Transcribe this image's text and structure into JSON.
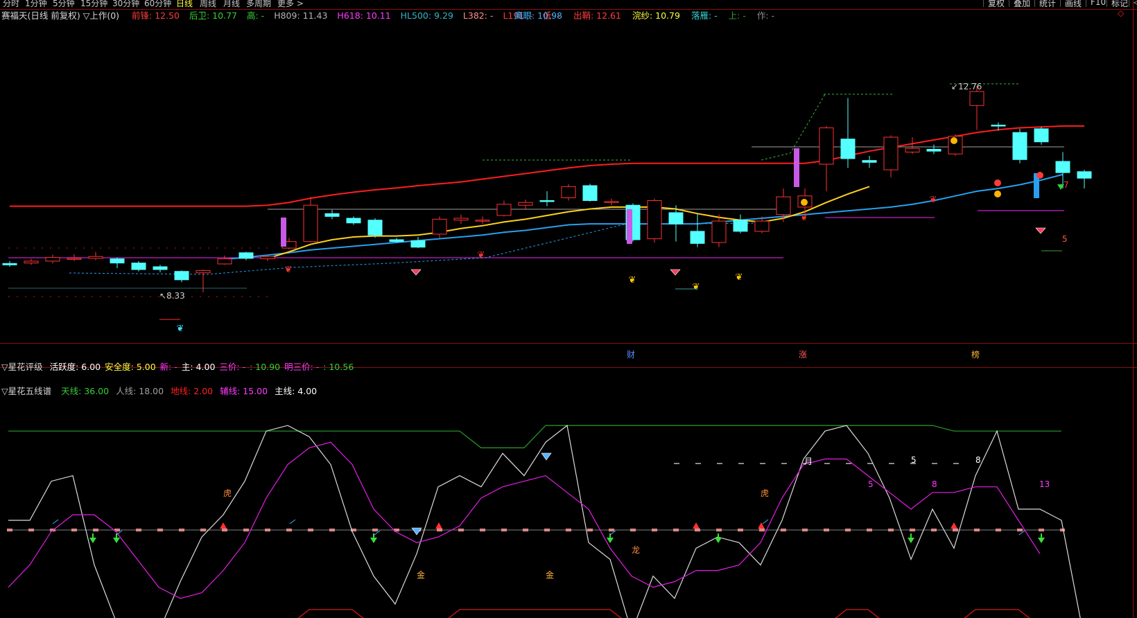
{
  "periods": [
    {
      "label": "分时",
      "x": 4,
      "active": false
    },
    {
      "label": "1分钟",
      "x": 36,
      "active": false
    },
    {
      "label": "5分钟",
      "x": 76,
      "active": false
    },
    {
      "label": "15分钟",
      "x": 116,
      "active": false
    },
    {
      "label": "30分钟",
      "x": 162,
      "active": false
    },
    {
      "label": "60分钟",
      "x": 208,
      "active": false
    },
    {
      "label": "日线",
      "x": 254,
      "active": true
    },
    {
      "label": "周线",
      "x": 288,
      "active": false
    },
    {
      "label": "月线",
      "x": 322,
      "active": false
    },
    {
      "label": "多周期",
      "x": 355,
      "active": false
    },
    {
      "label": "更多 >",
      "x": 400,
      "active": false
    }
  ],
  "toolbar": [
    {
      "label": "复权",
      "x": 1418
    },
    {
      "label": "叠加",
      "x": 1455
    },
    {
      "label": "统计",
      "x": 1492
    },
    {
      "label": "画线",
      "x": 1529
    },
    {
      "label": "F10",
      "x": 1566
    },
    {
      "label": "标记",
      "x": 1596
    }
  ],
  "toolbar_tail": "◁",
  "main": {
    "title": "赛福天(日线 前复权) ▽上作(0)",
    "metrics": [
      {
        "label": "前锋:",
        "value": "12.50",
        "color": "#ff3c3c"
      },
      {
        "label": "后卫:",
        "value": "10.77",
        "color": "#36d036"
      },
      {
        "label": "高:",
        "value": "-",
        "color": "#36d036"
      },
      {
        "label": "H809:",
        "value": "11.43",
        "color": "#b4b4b4"
      },
      {
        "label": "H618:",
        "value": "10.11",
        "color": "#ff3cff"
      },
      {
        "label": "HL500:",
        "value": "9.29",
        "color": "#36b4c8"
      },
      {
        "label": "L382:",
        "value": "-",
        "color": "#ff8c8c"
      },
      {
        "label": "L191:",
        "value": "-",
        "color": "#ff3c3c"
      },
      {
        "label": "低:",
        "value": "-",
        "color": "#ff3c3c"
      }
    ],
    "metrics2": [
      {
        "label": "鹰眼:",
        "value": "10.98",
        "color": "#3cb4ff"
      },
      {
        "label": "出鞘:",
        "value": "12.61",
        "color": "#ff3c3c"
      },
      {
        "label": "浣纱:",
        "value": "10.79",
        "color": "#ffff3c"
      },
      {
        "label": "落雁:",
        "value": "-",
        "color": "#36d0d0"
      },
      {
        "label": "上:",
        "value": "-",
        "color": "#36a036"
      },
      {
        "label": "作:",
        "value": "-",
        "color": "#8c8c8c"
      }
    ],
    "price_high_label": "12.76",
    "price_low_label": "8.33",
    "right_number": "5",
    "right_number2": "7",
    "markers": [
      {
        "text": "财",
        "color": "#5a8cff"
      },
      {
        "text": "涨",
        "color": "#ff5a5a"
      },
      {
        "text": "榜",
        "color": "#ffb43c"
      }
    ]
  },
  "panel2": {
    "title": "▽星花评级",
    "metrics": [
      {
        "label": "活跃度:",
        "value": "6.00",
        "color": "#ffffff"
      },
      {
        "label": "安全度:",
        "value": "5.00",
        "color": "#ffff3c"
      },
      {
        "label": "新:",
        "value": "-",
        "color": "#ff3cff"
      },
      {
        "label": "主:",
        "value": "4.00",
        "color": "#ffffff"
      },
      {
        "label": "三价:",
        "value": "-",
        "color": "#ff3cff"
      },
      {
        "label": ":",
        "value": "10.90",
        "color": "#36d036"
      },
      {
        "label": "明三价:",
        "value": "-",
        "color": "#ff3cff"
      },
      {
        "label": ":",
        "value": "10.56",
        "color": "#36d036"
      }
    ]
  },
  "panel3": {
    "title": "▽星花五线谱",
    "metrics": [
      {
        "label": "天线:",
        "value": "36.00",
        "color": "#36d036"
      },
      {
        "label": "人线:",
        "value": "18.00",
        "color": "#a0a0a0"
      },
      {
        "label": "地线:",
        "value": "2.00",
        "color": "#ff2020"
      },
      {
        "label": "辅线:",
        "value": "15.00",
        "color": "#ff3cff"
      },
      {
        "label": "主线:",
        "value": "4.00",
        "color": "#ffffff"
      }
    ],
    "annotations": [
      {
        "text": "虎",
        "color": "#ff8c3c"
      },
      {
        "text": "金",
        "color": "#ffb43c"
      },
      {
        "text": "金",
        "color": "#ffb43c"
      },
      {
        "text": "龙",
        "color": "#ff8c3c"
      },
      {
        "text": "虎",
        "color": "#ff8c3c"
      },
      {
        "text": "月",
        "color": "#ffffff"
      },
      {
        "text": "5",
        "color": "#ffffff"
      },
      {
        "text": "8",
        "color": "#ffffff"
      },
      {
        "text": "5",
        "color": "#ff3cff"
      },
      {
        "text": "8",
        "color": "#ff3cff"
      },
      {
        "text": "13",
        "color": "#ff3cff"
      }
    ]
  },
  "chart_data": {
    "type": "candlestick",
    "title": "赛福天(日线 前复权)",
    "candles": [
      {
        "o": 8.95,
        "c": 8.92,
        "h": 9.0,
        "l": 8.88
      },
      {
        "o": 8.96,
        "c": 9.0,
        "h": 9.05,
        "l": 8.92
      },
      {
        "o": 9.0,
        "c": 9.08,
        "h": 9.14,
        "l": 8.95
      },
      {
        "o": 9.06,
        "c": 9.06,
        "h": 9.15,
        "l": 9.0
      },
      {
        "o": 9.06,
        "c": 9.1,
        "h": 9.2,
        "l": 9.02
      },
      {
        "o": 9.05,
        "c": 8.96,
        "h": 9.08,
        "l": 8.85
      },
      {
        "o": 8.96,
        "c": 8.82,
        "h": 9.0,
        "l": 8.78
      },
      {
        "o": 8.88,
        "c": 8.82,
        "h": 8.92,
        "l": 8.76
      },
      {
        "o": 8.78,
        "c": 8.6,
        "h": 8.8,
        "l": 8.55
      },
      {
        "o": 8.75,
        "c": 8.8,
        "h": 8.82,
        "l": 8.33
      },
      {
        "o": 8.94,
        "c": 9.05,
        "h": 9.12,
        "l": 8.92
      },
      {
        "o": 9.18,
        "c": 9.06,
        "h": 9.2,
        "l": 9.02
      },
      {
        "o": 9.05,
        "c": 9.1,
        "h": 9.14,
        "l": 9.0
      },
      {
        "o": 9.28,
        "c": 9.42,
        "h": 9.5,
        "l": 9.25
      },
      {
        "o": 9.42,
        "c": 10.2,
        "h": 10.38,
        "l": 9.4
      },
      {
        "o": 10.02,
        "c": 9.96,
        "h": 10.1,
        "l": 9.9
      },
      {
        "o": 9.92,
        "c": 9.82,
        "h": 9.96,
        "l": 9.78
      },
      {
        "o": 9.88,
        "c": 9.56,
        "h": 9.92,
        "l": 9.5
      },
      {
        "o": 9.46,
        "c": 9.42,
        "h": 9.5,
        "l": 9.4
      },
      {
        "o": 9.44,
        "c": 9.3,
        "h": 9.52,
        "l": 9.28
      },
      {
        "o": 9.58,
        "c": 9.9,
        "h": 9.96,
        "l": 9.5
      },
      {
        "o": 9.88,
        "c": 9.92,
        "h": 10.0,
        "l": 9.8
      },
      {
        "o": 9.88,
        "c": 9.88,
        "h": 9.96,
        "l": 9.8
      },
      {
        "o": 9.98,
        "c": 10.22,
        "h": 10.3,
        "l": 9.96
      },
      {
        "o": 10.2,
        "c": 10.26,
        "h": 10.32,
        "l": 10.1
      },
      {
        "o": 10.3,
        "c": 10.28,
        "h": 10.5,
        "l": 10.18
      },
      {
        "o": 10.36,
        "c": 10.6,
        "h": 10.65,
        "l": 10.3
      },
      {
        "o": 10.62,
        "c": 10.3,
        "h": 10.66,
        "l": 10.28
      },
      {
        "o": 10.26,
        "c": 10.28,
        "h": 10.34,
        "l": 10.2
      },
      {
        "o": 10.2,
        "c": 9.46,
        "h": 10.24,
        "l": 9.42
      },
      {
        "o": 9.48,
        "c": 10.3,
        "h": 10.34,
        "l": 9.4
      },
      {
        "o": 10.04,
        "c": 9.8,
        "h": 10.2,
        "l": 9.42
      },
      {
        "o": 9.64,
        "c": 9.38,
        "h": 10.02,
        "l": 9.3
      },
      {
        "o": 9.4,
        "c": 9.86,
        "h": 10.0,
        "l": 9.3
      },
      {
        "o": 9.88,
        "c": 9.64,
        "h": 10.0,
        "l": 9.6
      },
      {
        "o": 9.64,
        "c": 9.86,
        "h": 9.96,
        "l": 9.6
      },
      {
        "o": 10.0,
        "c": 10.38,
        "h": 10.56,
        "l": 9.84
      },
      {
        "o": 10.16,
        "c": 10.4,
        "h": 10.56,
        "l": 10.02
      },
      {
        "o": 11.08,
        "c": 11.86,
        "h": 11.9,
        "l": 10.5
      },
      {
        "o": 11.62,
        "c": 11.2,
        "h": 12.5,
        "l": 11.0
      },
      {
        "o": 11.16,
        "c": 11.12,
        "h": 11.26,
        "l": 11.0
      },
      {
        "o": 10.96,
        "c": 11.66,
        "h": 11.7,
        "l": 10.8
      },
      {
        "o": 11.34,
        "c": 11.42,
        "h": 11.66,
        "l": 11.3
      },
      {
        "o": 11.4,
        "c": 11.36,
        "h": 11.5,
        "l": 11.3
      },
      {
        "o": 11.3,
        "c": 11.68,
        "h": 11.72,
        "l": 11.26
      },
      {
        "o": 12.34,
        "c": 12.64,
        "h": 12.76,
        "l": 11.82
      },
      {
        "o": 11.92,
        "c": 11.9,
        "h": 11.98,
        "l": 11.8
      },
      {
        "o": 11.76,
        "c": 11.18,
        "h": 11.84,
        "l": 11.1
      },
      {
        "o": 11.84,
        "c": 11.56,
        "h": 11.88,
        "l": 11.5
      },
      {
        "o": 11.14,
        "c": 10.9,
        "h": 11.34,
        "l": 10.56
      },
      {
        "o": 10.92,
        "c": 10.78,
        "h": 10.96,
        "l": 10.56
      }
    ],
    "series": [
      {
        "name": "前锋",
        "color": "#ff1e1e",
        "values": [
          10.18,
          10.18,
          10.18,
          10.18,
          10.18,
          10.18,
          10.18,
          10.18,
          10.18,
          10.18,
          10.18,
          10.18,
          10.2,
          10.26,
          10.35,
          10.42,
          10.48,
          10.53,
          10.57,
          10.62,
          10.66,
          10.7,
          10.76,
          10.82,
          10.88,
          10.94,
          11.0,
          11.05,
          11.08,
          11.1,
          11.1,
          11.1,
          11.1,
          11.1,
          11.1,
          11.1,
          11.1,
          11.1,
          11.16,
          11.26,
          11.36,
          11.44,
          11.52,
          11.6,
          11.68,
          11.76,
          11.82,
          11.86,
          11.88,
          11.9,
          11.9
        ]
      },
      {
        "name": "鹰眼",
        "color": "#28a0f0",
        "values": [
          null,
          null,
          null,
          null,
          null,
          null,
          null,
          null,
          null,
          null,
          9.04,
          9.08,
          9.13,
          9.18,
          9.24,
          9.28,
          9.32,
          9.36,
          9.4,
          9.44,
          9.48,
          9.52,
          9.56,
          9.62,
          9.66,
          9.72,
          9.78,
          9.8,
          9.8,
          9.8,
          9.8,
          9.8,
          9.8,
          9.84,
          9.88,
          9.92,
          9.96,
          10.0,
          10.04,
          10.08,
          10.12,
          10.16,
          10.22,
          10.3,
          10.4,
          10.5,
          10.56,
          10.64,
          10.74,
          10.86,
          null
        ]
      },
      {
        "name": "浣纱",
        "color": "#ffd21e",
        "values": [
          null,
          null,
          null,
          null,
          null,
          null,
          null,
          null,
          null,
          null,
          null,
          null,
          9.06,
          9.2,
          9.36,
          9.46,
          9.52,
          9.54,
          9.54,
          9.56,
          9.62,
          9.7,
          9.76,
          9.84,
          9.9,
          9.98,
          10.06,
          10.12,
          10.16,
          10.16,
          10.16,
          10.12,
          10.02,
          9.94,
          9.88,
          9.84,
          9.92,
          10.06,
          10.26,
          10.44,
          10.6,
          null,
          null,
          null,
          null,
          null,
          null,
          null,
          null,
          null,
          null
        ]
      }
    ],
    "oscillator": {
      "ylim": [
        0,
        40
      ],
      "series": [
        {
          "name": "天线",
          "color": "#28a028",
          "values": [
            36,
            36,
            36,
            36,
            36,
            36,
            36,
            36,
            36,
            36,
            36,
            36,
            36,
            36,
            36,
            36,
            36,
            36,
            36,
            36,
            36,
            36,
            33,
            33,
            33,
            37,
            37,
            37,
            37,
            37,
            37,
            37,
            37,
            37,
            37,
            37,
            37,
            37,
            37,
            37,
            37,
            37,
            37,
            37,
            36,
            36,
            36,
            36,
            36,
            36
          ]
        },
        {
          "name": "人线",
          "color": "#dcdcdc",
          "values": [
            20,
            20,
            27,
            28,
            12,
            2,
            2,
            0,
            9,
            17,
            21,
            27,
            36,
            37,
            35,
            30,
            18,
            10,
            5,
            14,
            26,
            28,
            26,
            32,
            28,
            34,
            37,
            16,
            13,
            0,
            10,
            6,
            15,
            17,
            16,
            12,
            20,
            31,
            36,
            37,
            32,
            24,
            13,
            22,
            15,
            28,
            36,
            22,
            22,
            20,
            0
          ]
        },
        {
          "name": "辅线",
          "color": "#e61ee6",
          "values": [
            8,
            12,
            18,
            21,
            21,
            18,
            13,
            8,
            6,
            7,
            11,
            16,
            24,
            30,
            33,
            34,
            30,
            22,
            18,
            16,
            17,
            19,
            24,
            26,
            27,
            28,
            25,
            22,
            15,
            10,
            8,
            9,
            11,
            11,
            12,
            16,
            24,
            30,
            31,
            31,
            28,
            25,
            22,
            25,
            25,
            26,
            26,
            20,
            14
          ]
        },
        {
          "name": "地线",
          "color": "#c81414",
          "values": [
            1,
            1,
            1,
            1,
            1,
            1,
            1,
            1,
            1,
            1,
            1,
            1,
            1,
            1,
            4,
            4,
            4,
            1,
            1,
            1,
            1,
            4,
            4,
            4,
            4,
            4,
            4,
            4,
            4,
            1,
            1,
            1,
            1,
            1,
            1,
            1,
            1,
            1,
            1,
            4,
            4,
            1,
            1,
            1,
            1,
            4,
            4,
            4,
            1,
            1
          ]
        }
      ]
    }
  }
}
